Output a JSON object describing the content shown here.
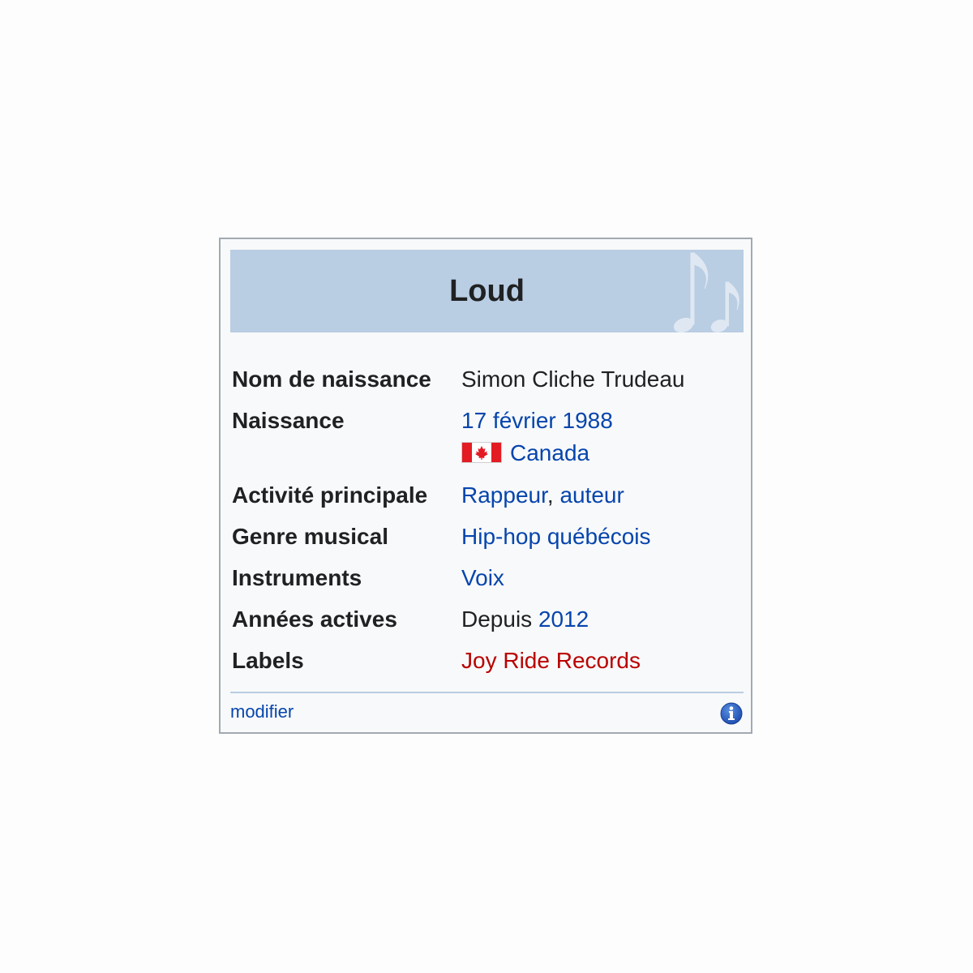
{
  "infobox": {
    "title": "Loud",
    "header_icon": "music-notes-icon",
    "header_color": "#b9cde3",
    "rows": [
      {
        "label": "Nom de naissance",
        "value": "Simon Cliche Trudeau"
      },
      {
        "label": "Naissance",
        "date": "17 février 1988",
        "country": "Canada",
        "country_flag": "canada-flag-icon"
      },
      {
        "label": "Activité principale",
        "value_1": "Rappeur",
        "separator": ", ",
        "value_2": "auteur"
      },
      {
        "label": "Genre musical",
        "value": "Hip-hop québécois"
      },
      {
        "label": "Instruments",
        "value": "Voix"
      },
      {
        "label": "Années actives",
        "prefix": "Depuis",
        "value": "2012"
      },
      {
        "label": "Labels",
        "value": "Joy Ride Records"
      }
    ],
    "footer": {
      "edit_link": "modifier",
      "info_icon": "info-icon"
    },
    "colors": {
      "link": "#0645ad",
      "redlink": "#ba0000",
      "text": "#202122"
    }
  }
}
